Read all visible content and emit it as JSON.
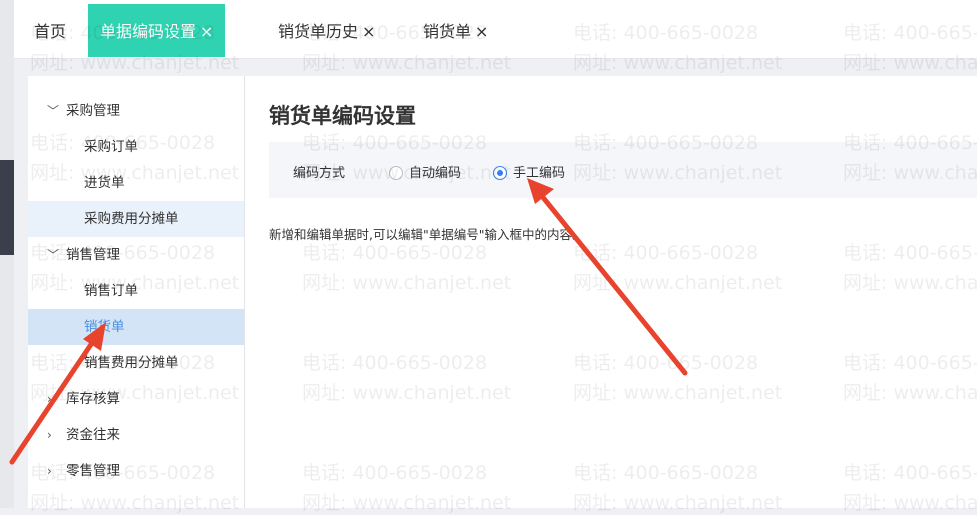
{
  "tabs": [
    {
      "label": "首页",
      "closable": false,
      "active": false
    },
    {
      "label": "单据编码设置",
      "closable": true,
      "active": true
    },
    {
      "label": "销货单历史",
      "closable": true,
      "active": false
    },
    {
      "label": "销货单",
      "closable": true,
      "active": false
    }
  ],
  "close_glyph": "×",
  "sidebar": {
    "groups": [
      {
        "label": "采购管理",
        "expanded": true,
        "children": [
          "采购订单",
          "进货单",
          "采购费用分摊单"
        ]
      },
      {
        "label": "销售管理",
        "expanded": true,
        "children": [
          "销售订单",
          "销货单",
          "销售费用分摊单"
        ]
      },
      {
        "label": "库存核算",
        "expanded": false
      },
      {
        "label": "资金往来",
        "expanded": false
      },
      {
        "label": "零售管理",
        "expanded": false
      }
    ],
    "selected": "销货单"
  },
  "content": {
    "title": "销货单编码设置",
    "option_label": "编码方式",
    "options": [
      {
        "label": "自动编码",
        "checked": false
      },
      {
        "label": "手工编码",
        "checked": true
      }
    ],
    "description": "新增和编辑单据时,可以编辑\"单据编号\"输入框中的内容。"
  },
  "watermark": {
    "phone": "电话: 400-665-0028",
    "site": "网址: www.chanjet.net"
  },
  "colors": {
    "active_tab": "#2fd3b1",
    "selected_item": "#4a90e2",
    "radio_checked": "#3b82f6",
    "arrow": "#e8432d"
  }
}
